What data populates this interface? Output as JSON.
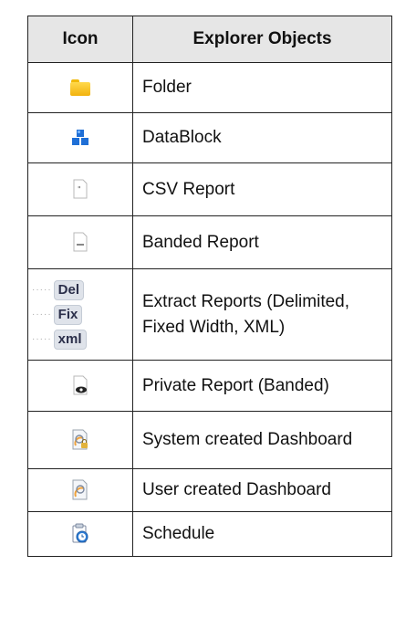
{
  "table": {
    "header_icon": "Icon",
    "header_objects": "Explorer Objects",
    "rows": [
      {
        "icon": "folder-icon",
        "label": "Folder"
      },
      {
        "icon": "datablock-icon",
        "label": "DataBlock"
      },
      {
        "icon": "csv-report-icon",
        "label": "CSV Report"
      },
      {
        "icon": "banded-report-icon",
        "label": "Banded Report"
      },
      {
        "icon": "extract-reports-icon",
        "label": "Extract Reports (Delimited, Fixed Width, XML)",
        "badges": [
          "Del",
          "Fix",
          "xml"
        ]
      },
      {
        "icon": "private-report-icon",
        "label": "Private Report (Banded)"
      },
      {
        "icon": "system-dashboard-icon",
        "label": "System created Dashboard"
      },
      {
        "icon": "user-dashboard-icon",
        "label": "User created Dashboard"
      },
      {
        "icon": "schedule-icon",
        "label": "Schedule"
      }
    ]
  },
  "colors": {
    "header_bg": "#e6e6e6",
    "folder": "#f2b20d",
    "datablock": "#1f6fd6"
  }
}
